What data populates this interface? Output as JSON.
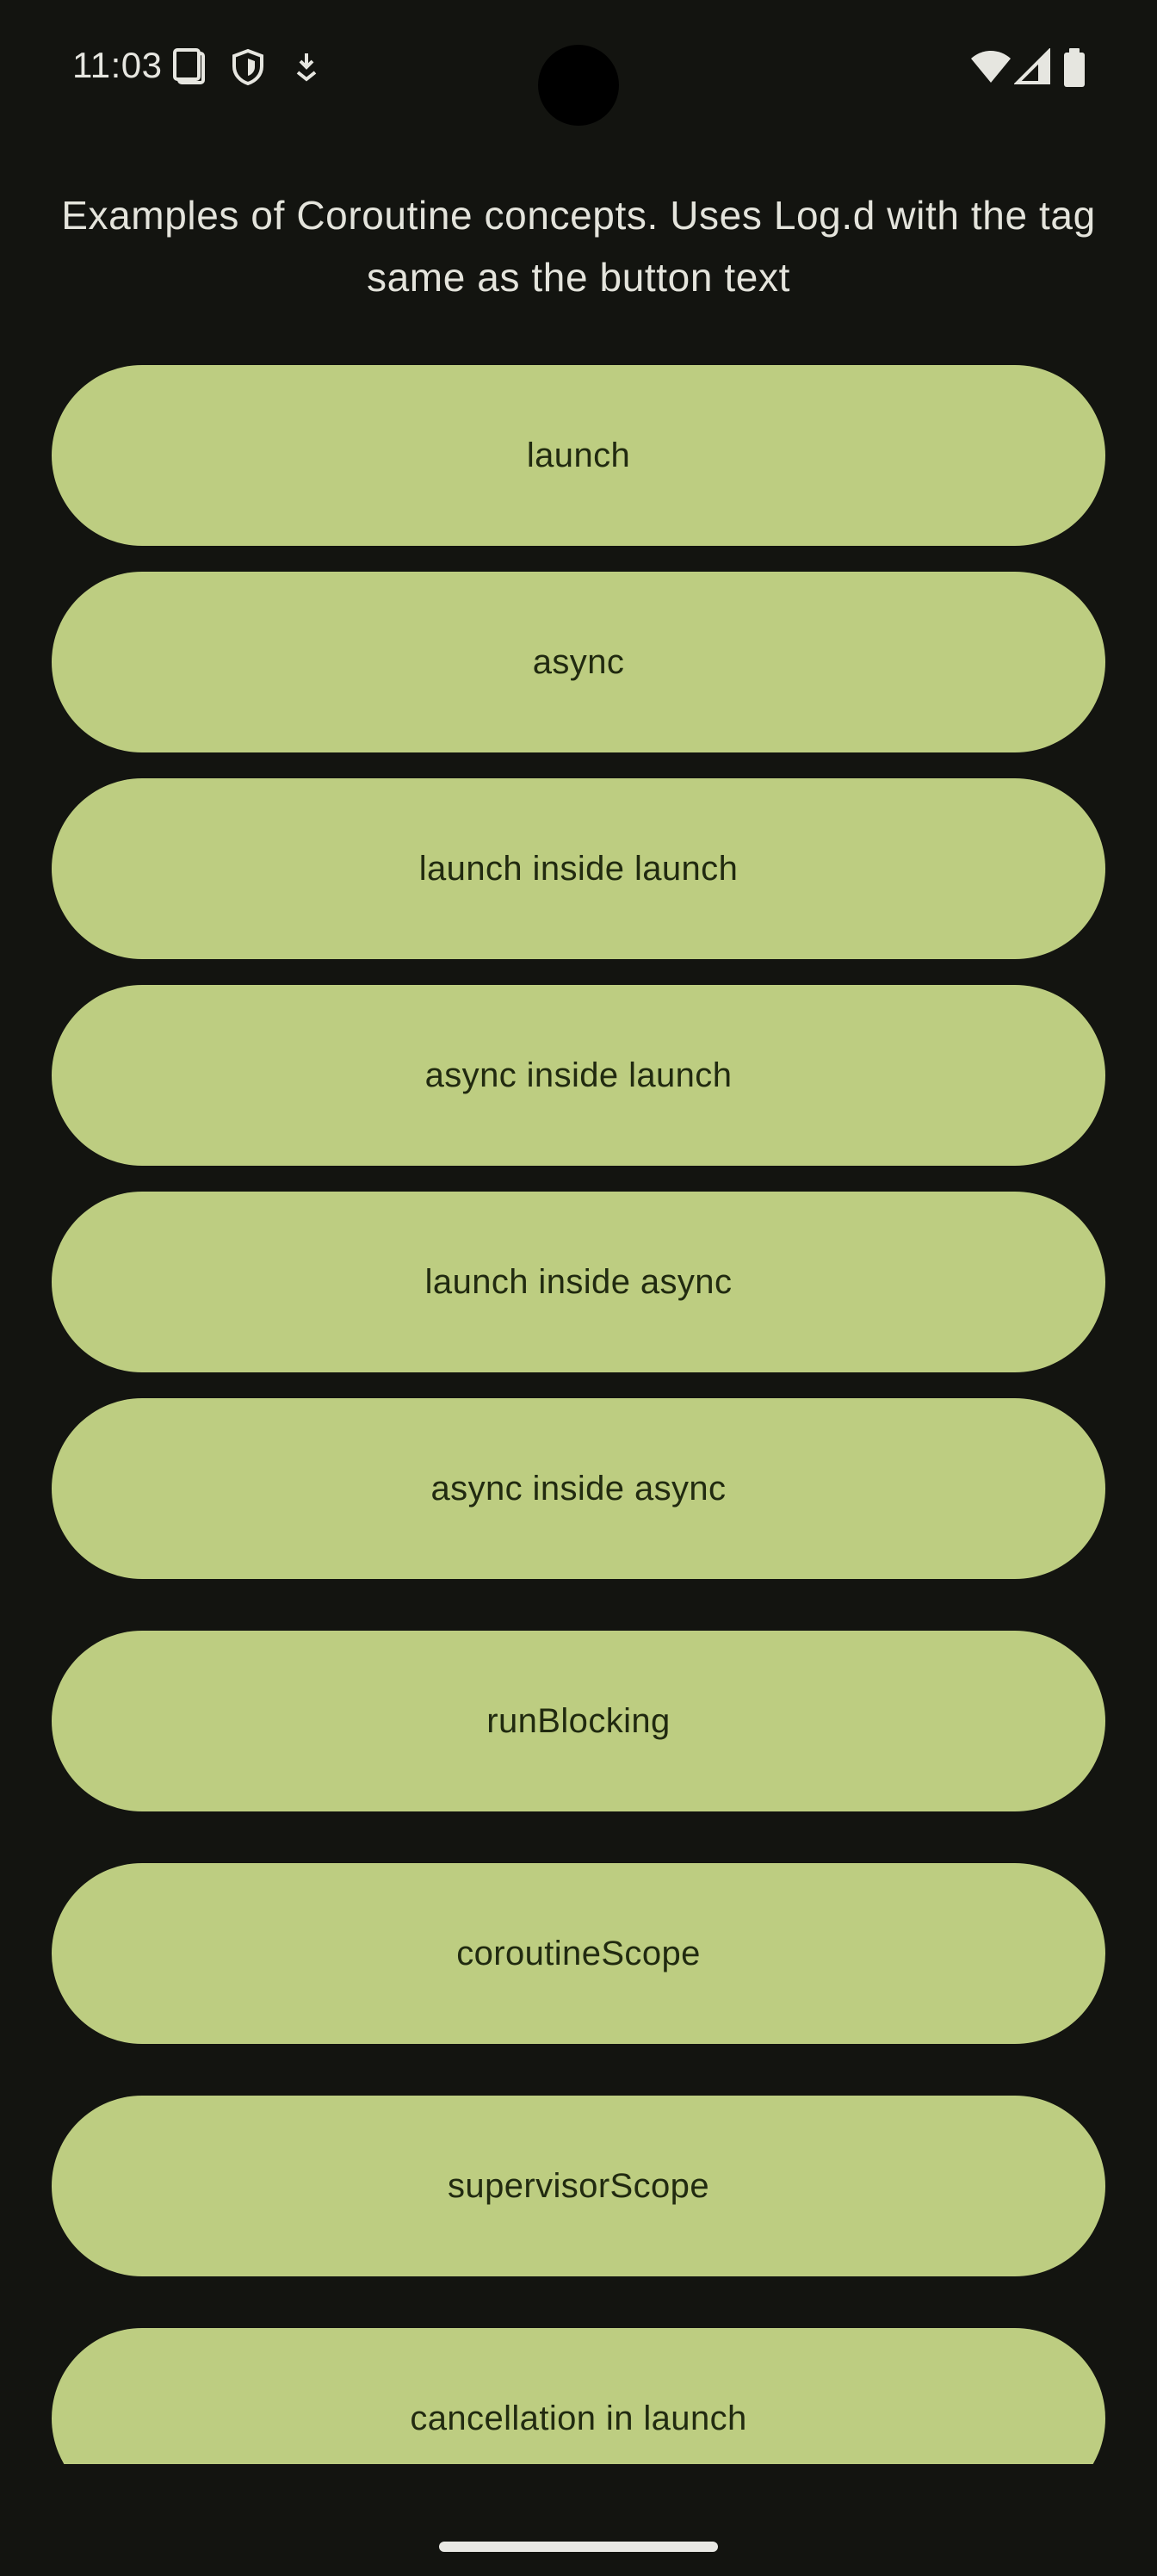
{
  "status_bar": {
    "time": "11:03",
    "left_icons": [
      "sim-card-icon",
      "shield-icon",
      "download-icon"
    ],
    "right_icons": [
      "wifi-icon",
      "signal-icon",
      "battery-icon"
    ]
  },
  "header": {
    "description": "Examples of Coroutine concepts. Uses Log.d with the tag same as the button text"
  },
  "buttons": [
    {
      "label": "launch"
    },
    {
      "label": "async"
    },
    {
      "label": "launch inside launch"
    },
    {
      "label": "async inside launch"
    },
    {
      "label": "launch inside async"
    },
    {
      "label": "async inside async"
    },
    {
      "label": "runBlocking"
    },
    {
      "label": "coroutineScope"
    },
    {
      "label": "supervisorScope"
    },
    {
      "label": "cancellation in launch"
    }
  ],
  "colors": {
    "background": "#131410",
    "button_fill": "#bdcd81",
    "button_text": "#212a10",
    "header_text": "#e4e4dc"
  }
}
